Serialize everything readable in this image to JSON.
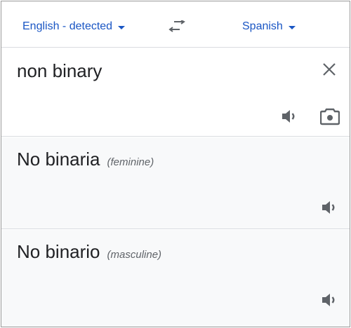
{
  "lang_bar": {
    "source_language": "English - detected",
    "target_language": "Spanish"
  },
  "source": {
    "text": "non binary"
  },
  "results": [
    {
      "text": "No binaria",
      "gender": "(feminine)"
    },
    {
      "text": "No binario",
      "gender": "(masculine)"
    }
  ],
  "colors": {
    "accent": "#1a56c4",
    "icon": "#5f6368",
    "result_bg": "#f8f9fa",
    "divider": "#dadce0"
  },
  "icons": {
    "swap": "swap-languages-icon",
    "clear": "close-icon",
    "speaker": "speaker-icon",
    "camera": "camera-icon",
    "dropdown": "chevron-down-icon"
  }
}
